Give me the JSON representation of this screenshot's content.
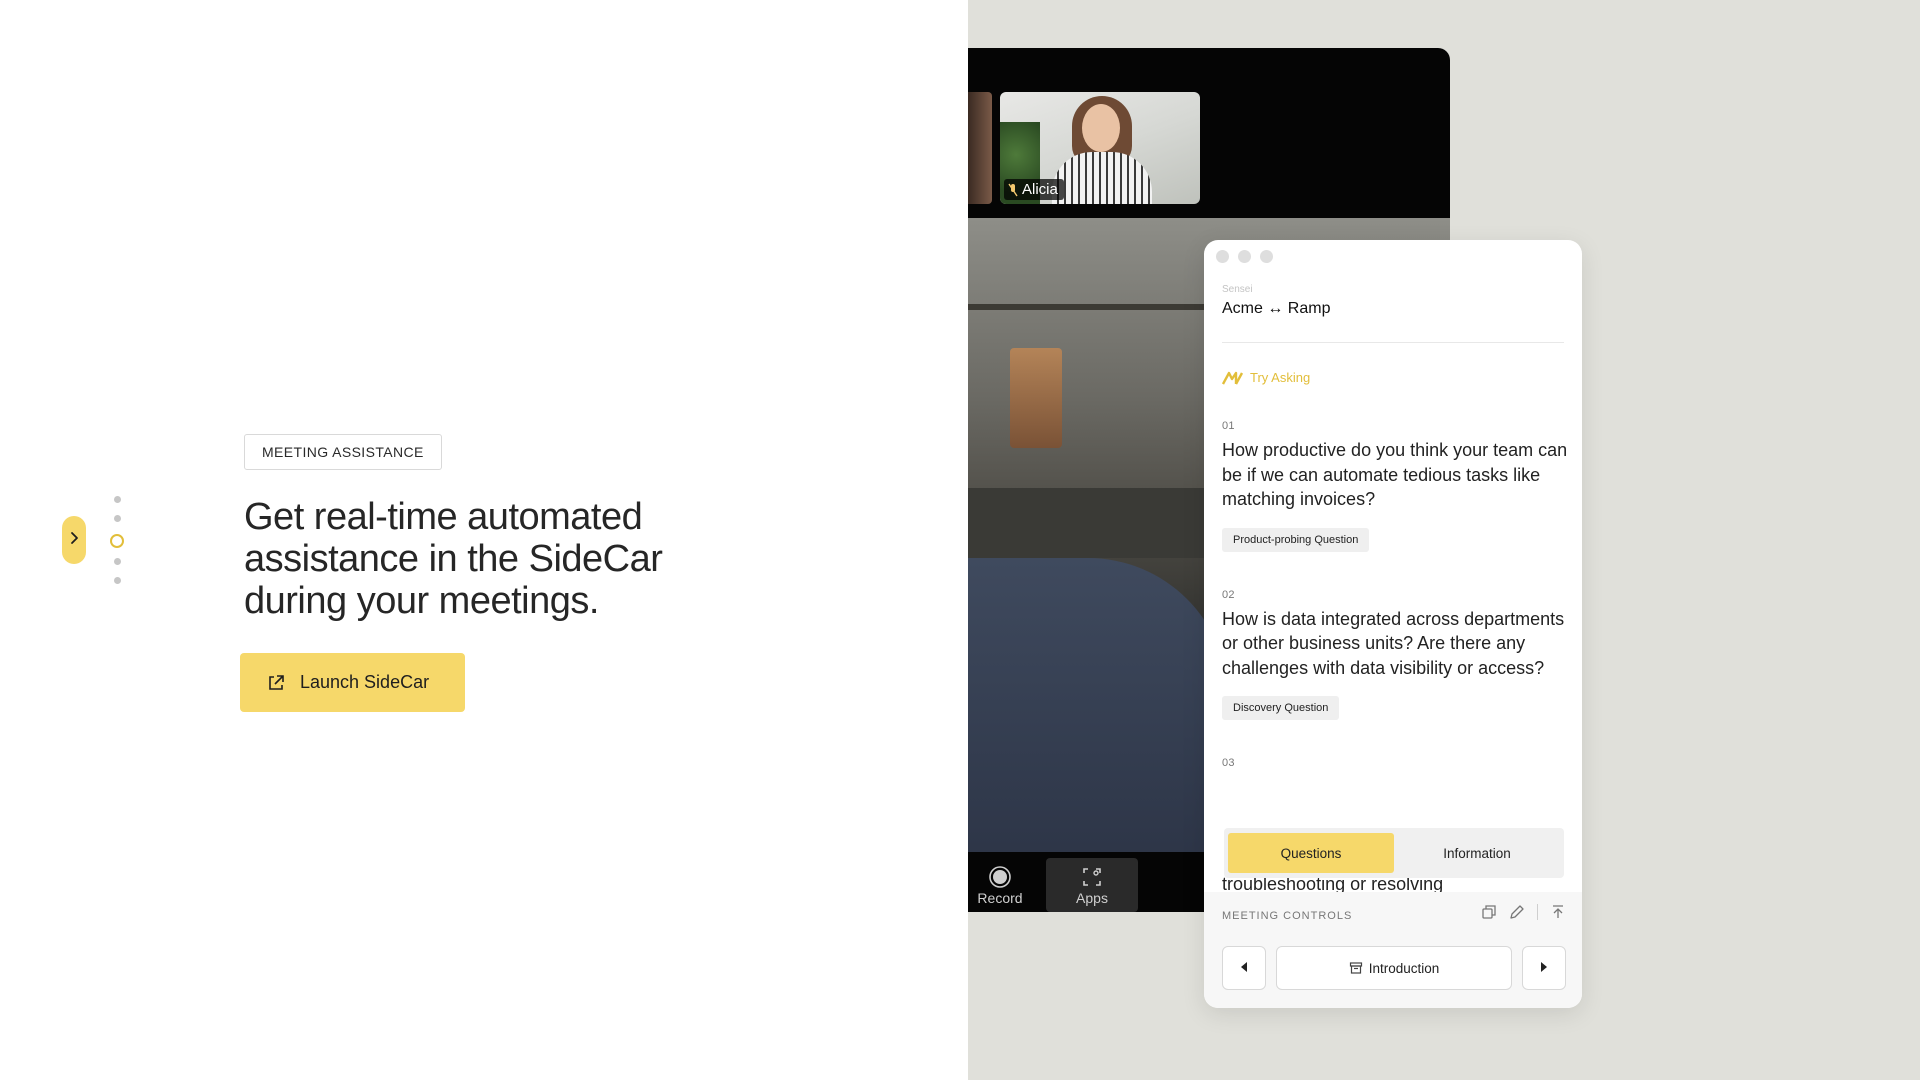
{
  "hero": {
    "badge": "MEETING ASSISTANCE",
    "headline": "Get real-time automated assistance in the SideCar during your meetings.",
    "cta_label": "Launch SideCar",
    "accent_color": "#f6d86a"
  },
  "pager": {
    "total": 5,
    "active": 3
  },
  "meeting": {
    "participant_name": "Alicia",
    "controls": [
      {
        "label": "Record",
        "icon": "record-icon"
      },
      {
        "label": "Apps",
        "icon": "apps-icon"
      }
    ]
  },
  "sidecar": {
    "app_label": "Sensei",
    "title": "Acme ↔ Ramp",
    "try_asking": "Try Asking",
    "questions": [
      {
        "num": "01",
        "text": "How productive do you think your team can be if we can automate tedious tasks like matching invoices?",
        "tag": "Product-probing Question"
      },
      {
        "num": "02",
        "text": "How is data integrated across departments or other business units? Are there any challenges with data visibility or access?",
        "tag": "Discovery Question"
      },
      {
        "num": "03"
      }
    ],
    "partial_text": "troubleshooting or resolving",
    "tabs": [
      {
        "label": "Questions",
        "active": true
      },
      {
        "label": "Information",
        "active": false
      }
    ],
    "meeting_controls_label": "MEETING CONTROLS",
    "current_section": "Introduction"
  }
}
